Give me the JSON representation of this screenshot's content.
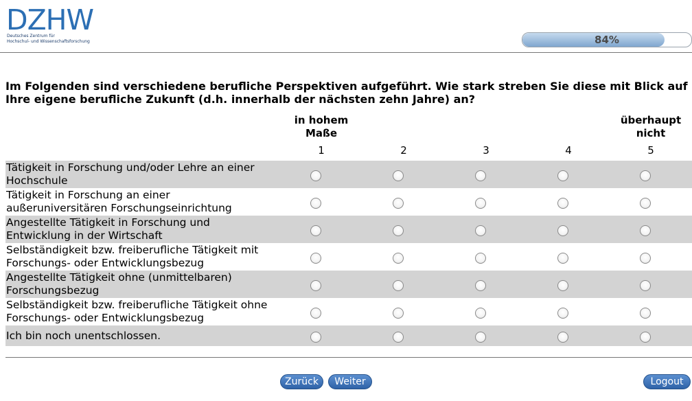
{
  "logo": {
    "text": "DZHW",
    "subtitle_line1": "Deutsches Zentrum für",
    "subtitle_line2": "Hochschul- und Wissenschaftsforschung"
  },
  "progress": {
    "label": "84%",
    "value": 0.84
  },
  "question": "Im Folgenden sind verschiedene berufliche Perspektiven aufgeführt. Wie stark streben Sie diese mit Blick auf Ihre eigene berufliche Zukunft (d.h. innerhalb der nächsten zehn Jahre) an?",
  "scale": {
    "left_label_line1": "in hohem",
    "left_label_line2": "Maße",
    "right_label_line1": "überhaupt",
    "right_label_line2": "nicht",
    "numbers": [
      "1",
      "2",
      "3",
      "4",
      "5"
    ]
  },
  "rows": [
    {
      "line1": "Tätigkeit in Forschung und/oder Lehre an einer",
      "line2": "Hochschule"
    },
    {
      "line1": "Tätigkeit in Forschung an einer",
      "line2": "außeruniversitären Forschungseinrichtung"
    },
    {
      "line1": "Angestellte Tätigkeit in Forschung und",
      "line2": "Entwicklung in der Wirtschaft"
    },
    {
      "line1": "Selbständigkeit bzw. freiberufliche Tätigkeit mit",
      "line2": "Forschungs- oder Entwicklungsbezug"
    },
    {
      "line1": "Angestellte Tätigkeit ohne (unmittelbaren)",
      "line2": "Forschungsbezug"
    },
    {
      "line1": "Selbständigkeit bzw. freiberufliche Tätigkeit ohne",
      "line2": "Forschungs- oder Entwicklungsbezug"
    },
    {
      "line1": "Ich bin noch unentschlossen.",
      "line2": ""
    }
  ],
  "buttons": {
    "back": "Zurück",
    "next": "Weiter",
    "logout": "Logout"
  },
  "colors": {
    "accent": "#2f63a8",
    "row_shade": "#d3d3d3",
    "logo": "#2c6fb4"
  }
}
